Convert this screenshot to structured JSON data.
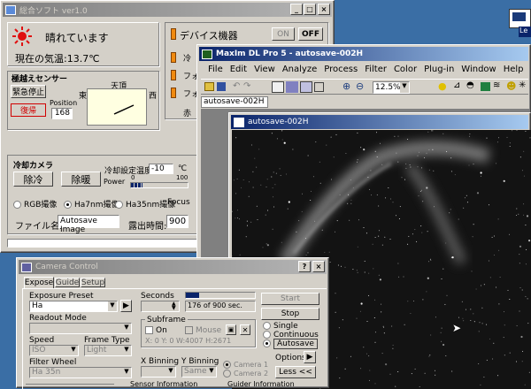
{
  "desktop_icon_label": "Le",
  "soft": {
    "title": "総合ソフト ver1.0",
    "weather": "晴れています",
    "temp": "現在の気温:13.7℃",
    "sensor": {
      "title": "極越えセンサー",
      "stop": "緊急停止",
      "return": "復帰",
      "position_label": "Position",
      "position_value": "168",
      "east": "東",
      "zenith": "天頂",
      "west": "西"
    },
    "device": {
      "title": "デバイス機器",
      "on": "ON",
      "off": "OFF",
      "item_a": "冷",
      "item_b": "フォ",
      "item_c": "フォ",
      "item_d": "赤"
    },
    "cool": {
      "title": "冷却カメラ",
      "cool": "除冷",
      "warm": "除暖",
      "setpoint_label": "冷却設定温度:",
      "setpoint": "-10",
      "unit": "℃",
      "power_label": "Power",
      "power_min": "0",
      "power_max": "100",
      "power_level": 0.2
    },
    "modes": {
      "rgb": "RGB撮像",
      "ha7": "Ha7nm撮像",
      "ha35": "Ha35nm撮像",
      "focus": "Focus"
    },
    "file_label": "ファイル名:",
    "file_value": "Autosave Image",
    "exp_label": "露出時間:",
    "exp_value": "900"
  },
  "maxim": {
    "title": "MaxIm DL Pro 5 - autosave-002H",
    "menu": [
      "File",
      "Edit",
      "View",
      "Analyze",
      "Process",
      "Filter",
      "Color",
      "Plug-in",
      "Window",
      "Help"
    ],
    "zoom": "12.5%",
    "doc_tab": "autosave-002H",
    "image_title": "autosave-002H"
  },
  "camera": {
    "title": "Camera Control",
    "help": "?",
    "tabs": [
      "Expose",
      "Guide",
      "Setup"
    ],
    "preset_label": "Exposure Preset",
    "preset_value": "Ha",
    "seconds_label": "Seconds",
    "progress_text": "176 of 900 sec.",
    "progress": 0.1956,
    "start": "Start",
    "stop": "Stop",
    "readout_label": "Readout Mode",
    "subframe_label": "Subframe",
    "on_label": "On",
    "mouse_label": "Mouse",
    "coords": "X: 0 Y: 0 W:4007 H:2671",
    "single": "Single",
    "continuous": "Continuous",
    "autosave": "Autosave",
    "speed_label": "Speed",
    "speed_value": "ISO",
    "frame_label": "Frame Type",
    "frame_value": "Light",
    "options": "Options",
    "filter_label": "Filter Wheel",
    "filter_value": "Ha 35n",
    "xbin_label": "X Binning",
    "ybin_label": "Y Binning",
    "ybin_value": "Same",
    "camera1": "Camera 1",
    "camera2": "Camera 2",
    "less": "Less <<",
    "sensor_info": "Sensor Information",
    "guider_info": "Guider Information"
  }
}
